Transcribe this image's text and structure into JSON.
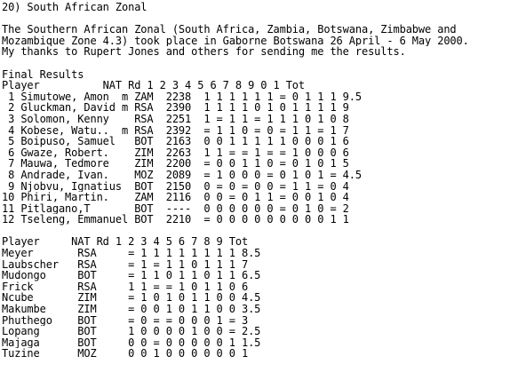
{
  "heading": "20) South African Zonal",
  "intro": [
    "The Southern African Zonal (South Africa, Zambia, Botswana, Zimbabwe and",
    "Mozambique Zone 4.3) took place in Gaborne Botswana 26 April - 6 May 2000.",
    "My thanks to Rupert Jones and others for sending me the results."
  ],
  "final": {
    "title": "Final Results",
    "header": "Player          NAT Rd 1 2 3 4 5 6 7 8 9 0 1 Tot",
    "rows": [
      " 1 Simutowe, Amon  m ZAM  2238  1 1 1 1 1 1 = 0 1 1 1 9.5",
      " 2 Gluckman, David m RSA  2390  1 1 1 1 0 1 0 1 1 1 1 9",
      " 3 Solomon, Kenny    RSA  2251  1 = 1 1 = 1 1 1 0 1 0 8",
      " 4 Kobese, Watu..  m RSA  2392  = 1 1 0 = 0 = 1 1 = 1 7",
      " 5 Boipuso, Samuel   BOT  2163  0 0 1 1 1 1 1 0 0 0 1 6",
      " 6 Gwaze, Robert.    ZIM  2263  1 1 = = 1 = = 1 0 0 0 6",
      " 7 Mauwa, Tedmore    ZIM  2200  = 0 0 1 1 0 = 0 1 0 1 5",
      " 8 Andrade, Ivan.    MOZ  2089  = 1 0 0 0 = 0 1 0 1 = 4.5",
      " 9 Njobvu, Ignatius  BOT  2150  0 = 0 = 0 0 = 1 1 = 0 4",
      "10 Phiri, Martin.    ZAM  2116  0 0 = 0 1 1 = 0 0 1 0 4",
      "11 Pitlagano,T       BOT  ----  0 0 0 0 0 0 = 0 1 0 = 2",
      "12 Tseleng, Emmanuel BOT  2210  = 0 0 0 0 0 0 0 0 0 1 1"
    ]
  },
  "second": {
    "header": "Player     NAT Rd 1 2 3 4 5 6 7 8 9 Tot",
    "rows": [
      "Meyer       RSA     = 1 1 1 1 1 1 1 1 8.5",
      "Laubscher   RSA     = 1 = 1 1 0 1 1 1 7",
      "Mudongo     BOT     = 1 1 0 1 1 0 1 1 6.5",
      "Frick       RSA     1 1 = = 1 0 1 1 0 6",
      "Ncube       ZIM     = 1 0 1 0 1 1 0 0 4.5",
      "Makumbe     ZIM     = 0 0 1 0 1 1 0 0 3.5",
      "Phuthego    BOT     = 0 = = 0 0 0 1 = 3",
      "Lopang      BOT     1 0 0 0 0 1 0 0 = 2.5",
      "Majaga      BOT     0 0 = 0 0 0 0 0 1 1.5",
      "Tuzine      MOZ     0 0 1 0 0 0 0 0 0 1"
    ]
  }
}
